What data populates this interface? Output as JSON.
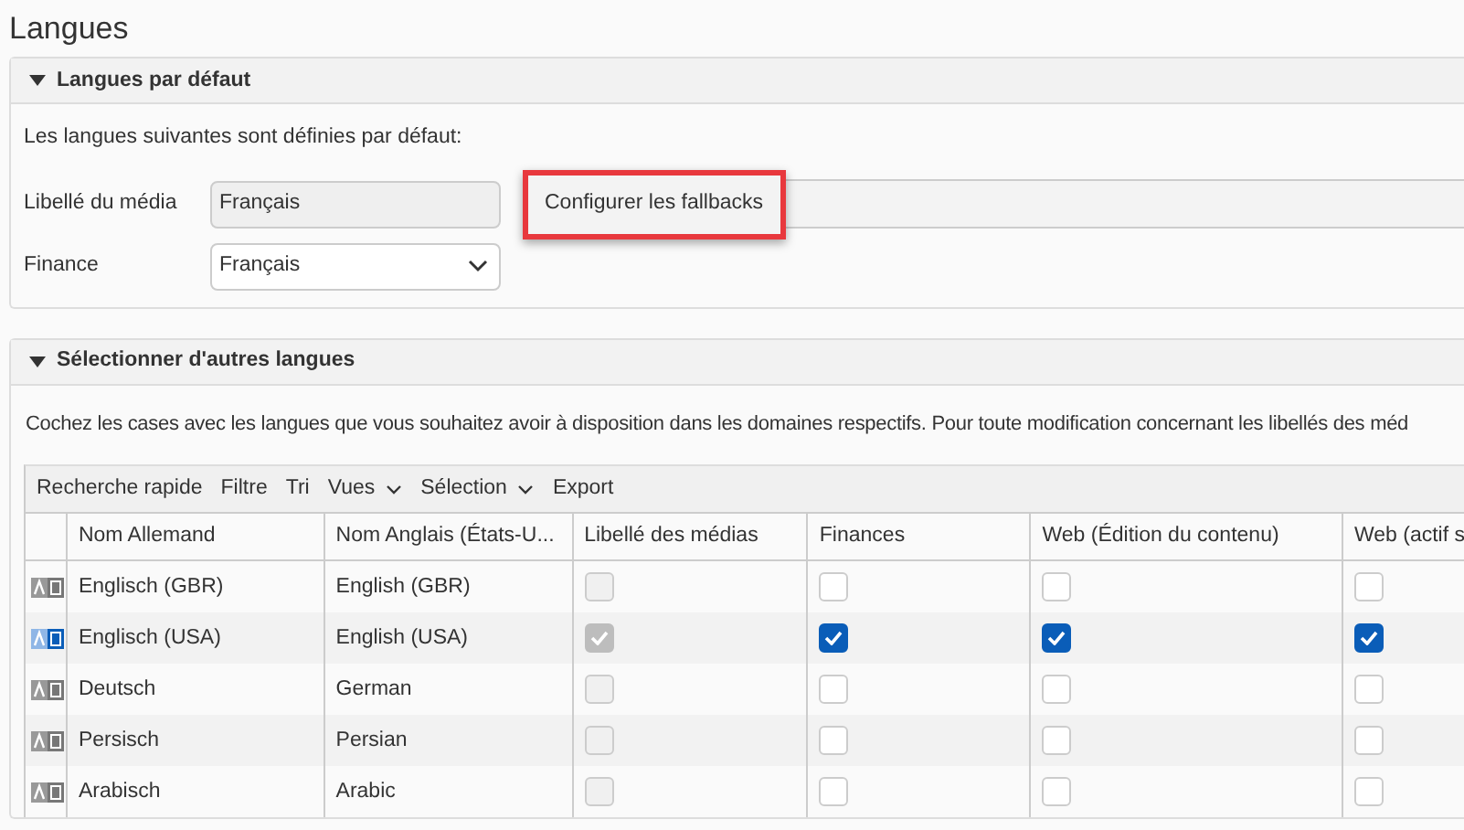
{
  "page": {
    "title": "Langues"
  },
  "default_panel": {
    "title": "Langues par défaut",
    "expanded": true,
    "intro": "Les langues suivantes sont définies par défaut:",
    "fields": [
      {
        "label": "Libellé du média",
        "kind": "readonly",
        "value": "Français"
      },
      {
        "label": "Finance",
        "kind": "select",
        "value": "Français"
      }
    ],
    "fallback_button": {
      "label": "Configurer les fallbacks",
      "highlighted": true
    }
  },
  "other_panel": {
    "title": "Sélectionner d'autres langues",
    "expanded": true,
    "intro": "Cochez les cases avec les langues que vous souhaitez avoir à disposition dans les domaines respectifs. Pour toute modification concernant les libellés des méd",
    "toolbar": [
      {
        "label": "Recherche rapide",
        "dropdown": false
      },
      {
        "label": "Filtre",
        "dropdown": false
      },
      {
        "label": "Tri",
        "dropdown": false
      },
      {
        "label": "Vues",
        "dropdown": true
      },
      {
        "label": "Sélection",
        "dropdown": true
      },
      {
        "label": "Export",
        "dropdown": false
      }
    ],
    "table": {
      "columns": [
        "Nom Allemand",
        "Nom Anglais (États-U...",
        "Libellé des médias",
        "Finances",
        "Web (Édition du contenu)",
        "Web (actif s"
      ],
      "rows": [
        {
          "active": false,
          "german": "Englisch (GBR)",
          "english": "English (GBR)",
          "media": false,
          "finances": false,
          "web_edit": false,
          "web_active": false
        },
        {
          "active": true,
          "german": "Englisch (USA)",
          "english": "English (USA)",
          "media": true,
          "finances": true,
          "web_edit": true,
          "web_active": true
        },
        {
          "active": false,
          "german": "Deutsch",
          "english": "German",
          "media": false,
          "finances": false,
          "web_edit": false,
          "web_active": false
        },
        {
          "active": false,
          "german": "Persisch",
          "english": "Persian",
          "media": false,
          "finances": false,
          "web_edit": false,
          "web_active": false
        },
        {
          "active": false,
          "german": "Arabisch",
          "english": "Arabic",
          "media": false,
          "finances": false,
          "web_edit": false,
          "web_active": false
        }
      ]
    }
  }
}
